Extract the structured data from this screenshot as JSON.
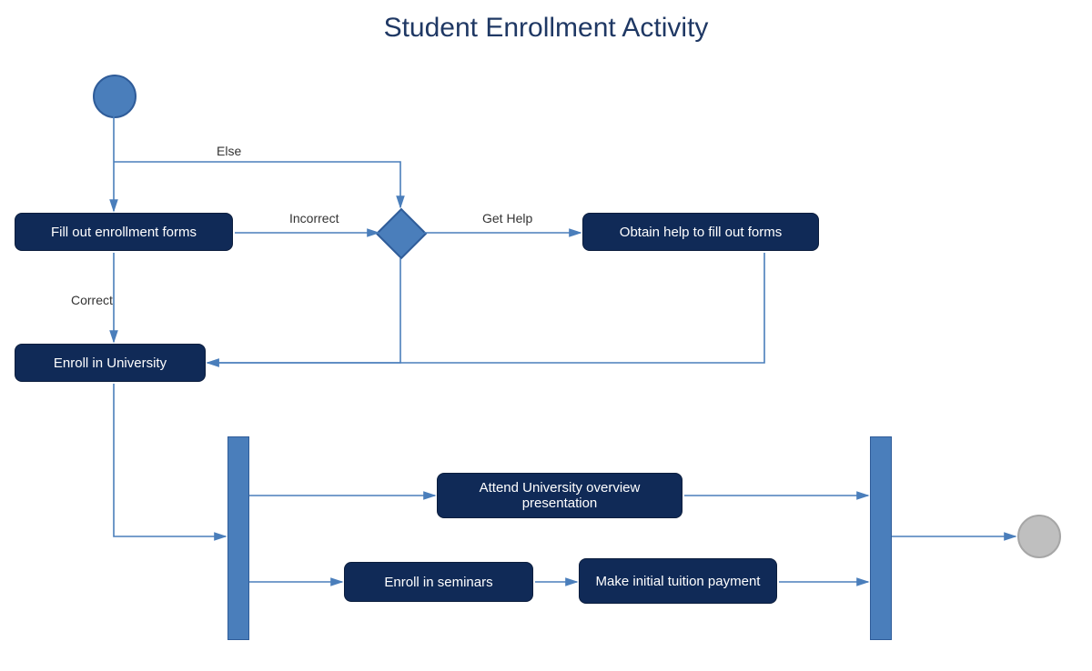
{
  "title": "Student Enrollment Activity",
  "nodes": {
    "fill_out_forms": "Fill out enrollment forms",
    "enroll_university": "Enroll in University",
    "obtain_help": "Obtain help to fill out forms",
    "attend_overview": "Attend University overview presentation",
    "enroll_seminars": "Enroll in seminars",
    "make_payment": "Make initial tuition payment"
  },
  "edges": {
    "else": "Else",
    "incorrect": "Incorrect",
    "get_help": "Get Help",
    "correct": "Correct"
  },
  "colors": {
    "activity_fill": "#102a57",
    "activity_text": "#ffffff",
    "line": "#4a7ebb",
    "title": "#1f3864",
    "start": "#4a7ebb",
    "end": "#bfbfbf"
  }
}
